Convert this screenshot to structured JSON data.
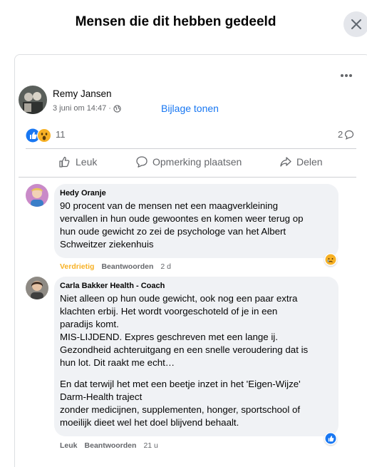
{
  "dialog": {
    "title": "Mensen die dit hebben gedeeld"
  },
  "post": {
    "author": "Remy Jansen",
    "meta": "3 juni om 14:47 ·",
    "attachment_link": "Bijlage tonen",
    "reactions_count": "11",
    "comments_count": "2",
    "reaction_types": [
      "like",
      "wow"
    ]
  },
  "actions": {
    "like": "Leuk",
    "comment": "Opmerking plaatsen",
    "share": "Delen"
  },
  "comments": [
    {
      "author": "Hedy Oranje",
      "text": "90 procent van de mensen net een maagverkleining\nvervallen in hun oude gewoontes en komen weer terug op\nhun oude gewicht zo zei de psychologe van het Albert\nSchweitzer ziekenhuis",
      "reaction_label": "Verdrietig",
      "reply_label": "Beantwoorden",
      "time": "2 d",
      "bubble_reaction": "sad"
    },
    {
      "author": "Carla Bakker Health - Coach",
      "text": "Niet alleen op hun oude gewicht, ook nog een paar extra\nklachten erbij. Het wordt voorgeschoteld of je in een\nparadijs komt.\nMIS-LIJDEND. Expres geschreven met een lange ij.\nGezondheid achteruitgang en een snelle veroudering dat is\nhun lot. Dit raakt me echt…",
      "text2": "En dat terwijl het met een beetje inzet in het 'Eigen-Wijze'\nDarm-Health traject\nzonder medicijnen, supplementen, honger, sportschool of\nmoeilijk dieet wel het doel blijvend behaalt.",
      "reaction_label": "Leuk",
      "reply_label": "Beantwoorden",
      "time": "21 u",
      "bubble_reaction": "like"
    }
  ],
  "colors": {
    "accent": "#1877f2",
    "reaction_sad": "#f7b125",
    "bubble_bg": "#f0f2f5",
    "secondary_text": "#65676b"
  }
}
